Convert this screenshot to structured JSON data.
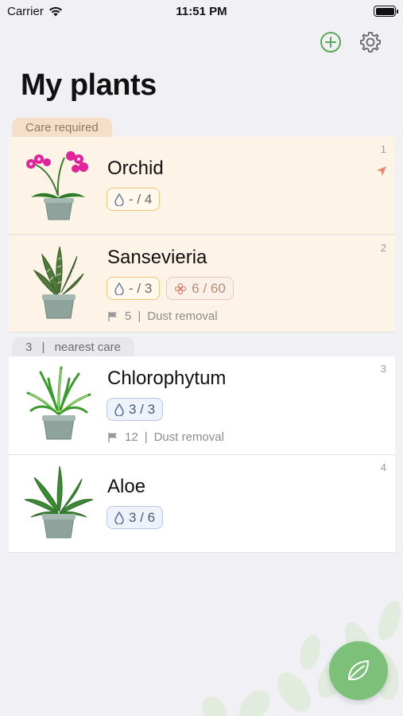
{
  "status_bar": {
    "carrier": "Carrier",
    "time": "11:51 PM"
  },
  "header": {
    "title": "My plants"
  },
  "sections": {
    "care_required": "Care required",
    "nearest_care": {
      "days": "3",
      "label": "nearest care"
    }
  },
  "plants": [
    {
      "name": "Orchid",
      "number": "1",
      "water": "- / 4"
    },
    {
      "name": "Sansevieria",
      "number": "2",
      "water": "- / 3",
      "fertilizer": "6 / 60",
      "task_days": "5",
      "task_label": "Dust removal"
    },
    {
      "name": "Chlorophytum",
      "number": "3",
      "water": "3 / 3",
      "task_days": "12",
      "task_label": "Dust removal"
    },
    {
      "name": "Aloe",
      "number": "4",
      "water": "3 / 6"
    }
  ],
  "icons": {
    "add": "plus-circle-icon",
    "settings": "gear-icon",
    "water": "water-drop-icon",
    "fertilizer": "flower-icon",
    "task": "flag-icon",
    "location": "location-arrow-icon",
    "fab": "leaf-icon"
  },
  "colors": {
    "accent_green": "#5aa85a",
    "care_background": "#fdf3e6",
    "care_chip": "#f6dfc8",
    "fab": "#7cc07a"
  }
}
